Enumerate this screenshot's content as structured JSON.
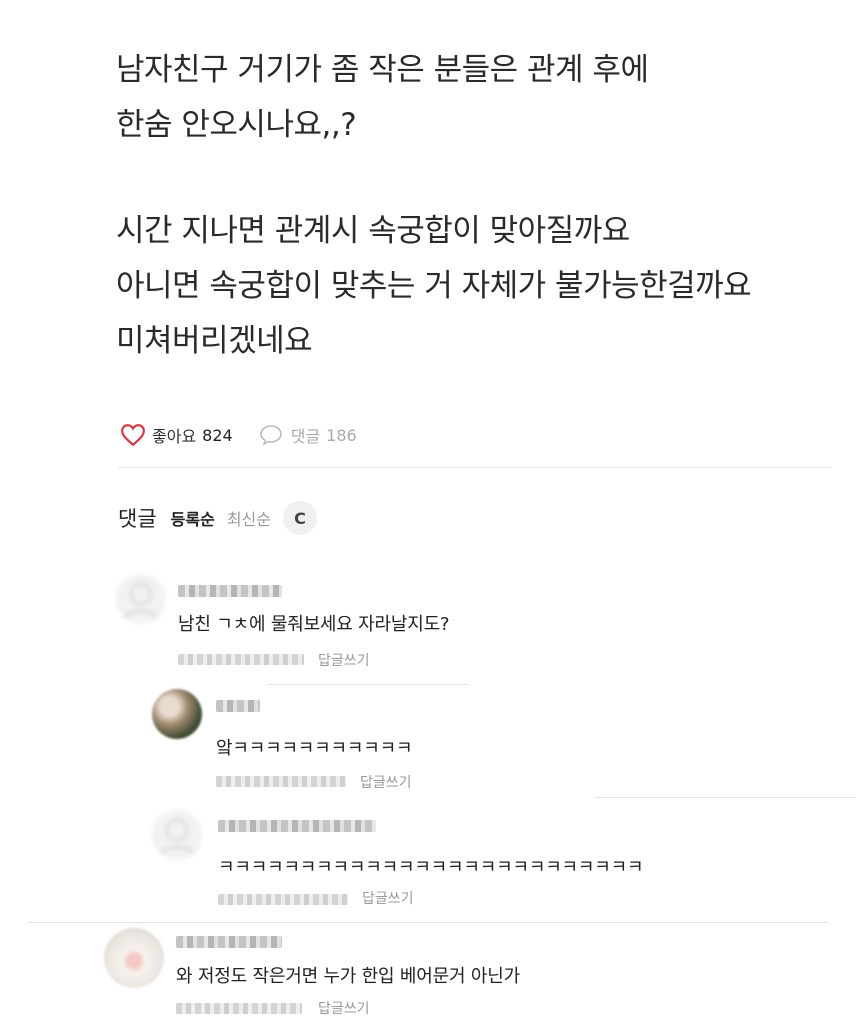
{
  "post": {
    "lines": [
      "남자친구 거기가 좀 작은 분들은 관계 후에",
      "한숨 안오시나요,,?",
      "시간 지나면 관계시 속궁합이 맞아질까요",
      "아니면 속궁합이 맞추는 거 자체가 불가능한걸까요",
      "미쳐버리겠네요"
    ]
  },
  "actions": {
    "like_label": "좋아요",
    "like_count": "824",
    "comment_label": "댓글",
    "comment_count": "186",
    "heart_icon": "heart-outline-icon",
    "comment_icon": "speech-bubble-icon",
    "heart_color": "#d9363e"
  },
  "sort": {
    "title": "댓글",
    "option_registered": "등록순",
    "option_latest": "최신순",
    "refresh_icon": "refresh-icon"
  },
  "comments": [
    {
      "text": "남친 ㄱㅊ에 물줘보세요 자라날지도?",
      "reply_label": "답글쓰기"
    },
    {
      "text": "앜ㅋㅋㅋㅋㅋㅋㅋㅋㅋㅋㅋ",
      "reply_label": "답글쓰기"
    },
    {
      "text": "ㅋㅋㅋㅋㅋㅋㅋㅋㅋㅋㅋㅋㅋㅋㅋㅋㅋㅋㅋㅋㅋㅋㅋㅋㅋㅋ",
      "reply_label": "답글쓰기"
    },
    {
      "text": "와 저정도 작은거면 누가 한입 베어문거 아닌가",
      "reply_label": "답글쓰기"
    }
  ]
}
